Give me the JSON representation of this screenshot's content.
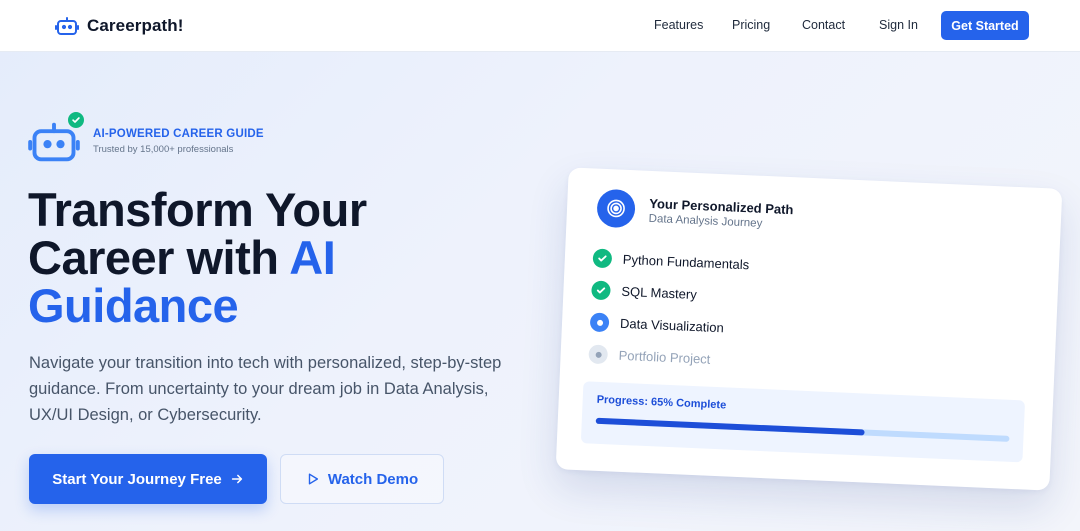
{
  "nav": {
    "brand": "Careerpath!",
    "links": [
      "Features",
      "Pricing",
      "Contact",
      "Sign In"
    ],
    "cta": "Get Started"
  },
  "badge": {
    "title": "AI-POWERED CAREER GUIDE",
    "subtitle": "Trusted by 15,000+ professionals",
    "icon": "robot-icon"
  },
  "hero": {
    "headline_line1": "Transform Your",
    "headline_line2_plain": "Career with ",
    "headline_line2_accent": "AI",
    "headline_line3_accent": "Guidance",
    "description": "Navigate your transition into tech with personalized, step-by-step guidance. From uncertainty to your dream job in Data Analysis, UX/UI Design, or Cybersecurity.",
    "primary_button": "Start Your Journey Free",
    "secondary_button": "Watch Demo"
  },
  "path_card": {
    "title": "Your Personalized Path",
    "subtitle": "Data Analysis Journey",
    "steps": [
      {
        "label": "Python Fundamentals",
        "status": "done"
      },
      {
        "label": "SQL Mastery",
        "status": "done"
      },
      {
        "label": "Data Visualization",
        "status": "current"
      },
      {
        "label": "Portfolio Project",
        "status": "pending"
      }
    ],
    "progress_label": "Progress: 65% Complete",
    "progress_value": 65
  },
  "colors": {
    "accent": "#2563eb",
    "success": "#10b981",
    "text": "#0f172a"
  }
}
